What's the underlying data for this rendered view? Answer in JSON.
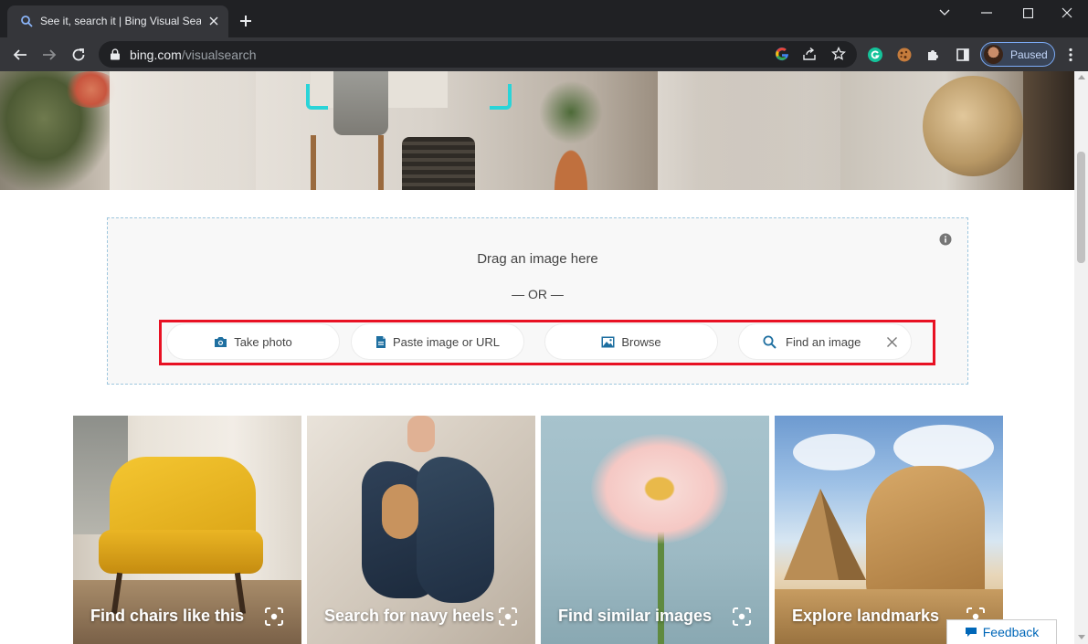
{
  "browser": {
    "tab_title": "See it, search it | Bing Visual Search",
    "url_host": "bing.com",
    "url_path": "/visualsearch",
    "profile_label": "Paused",
    "icons": [
      "back-icon",
      "forward-icon",
      "reload-icon",
      "lock-icon",
      "google-icon",
      "share-icon",
      "bookmark-star-icon",
      "grammarly-icon",
      "cookie-extension-icon",
      "extensions-puzzle-icon",
      "side-panel-icon",
      "menu-dots-icon",
      "minimize-icon",
      "maximize-icon",
      "close-icon"
    ]
  },
  "dropzone": {
    "drag_text": "Drag an image here",
    "or_text": "— OR —",
    "buttons": {
      "take_photo": "Take photo",
      "paste": "Paste image or URL",
      "browse": "Browse",
      "find": "Find an image"
    },
    "highlight_color": "#e81123"
  },
  "cards": [
    {
      "label": "Find chairs like this"
    },
    {
      "label": "Search for navy heels"
    },
    {
      "label": "Find similar images"
    },
    {
      "label": "Explore landmarks"
    }
  ],
  "feedback": {
    "label": "Feedback"
  },
  "colors": {
    "accent": "#0067b8",
    "icon_blue": "#1e6fa0",
    "dropzone_border": "#9fc7de",
    "chrome_dark": "#202124",
    "chrome_toolbar": "#35363a"
  }
}
